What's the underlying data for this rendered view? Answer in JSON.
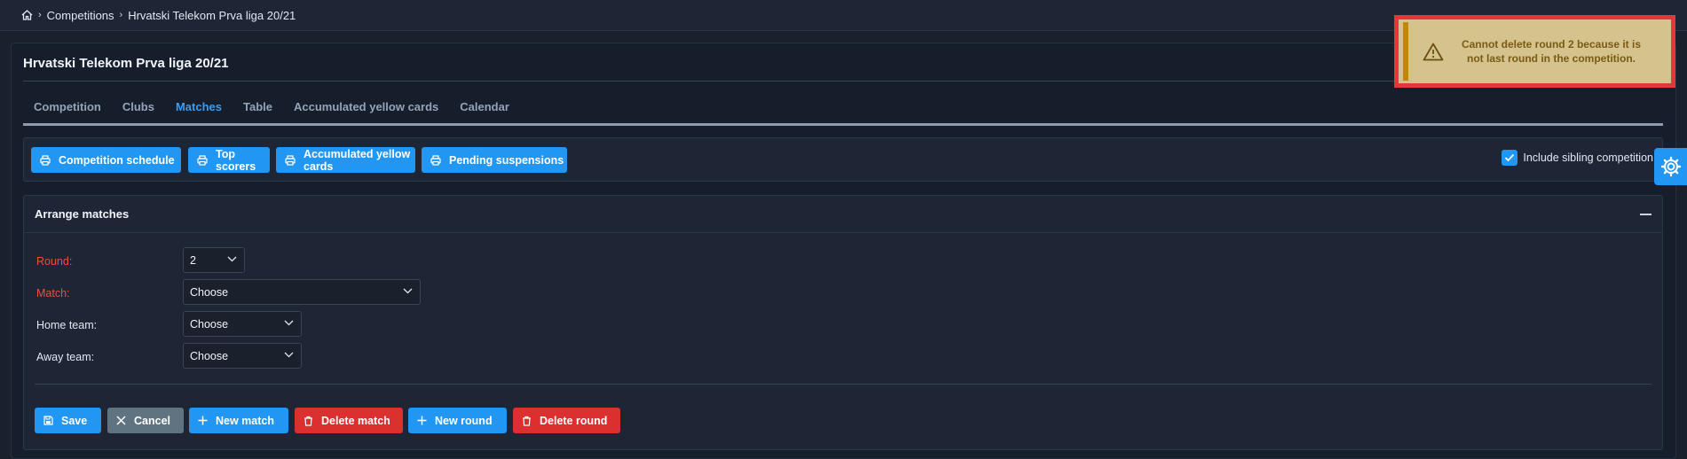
{
  "breadcrumb": {
    "items": [
      "Competitions",
      "Hrvatski Telekom Prva liga 20/21"
    ]
  },
  "page": {
    "title": "Hrvatski Telekom Prva liga 20/21"
  },
  "tabs": [
    {
      "label": "Competition",
      "active": false
    },
    {
      "label": "Clubs",
      "active": false
    },
    {
      "label": "Matches",
      "active": true
    },
    {
      "label": "Table",
      "active": false
    },
    {
      "label": "Accumulated yellow cards",
      "active": false
    },
    {
      "label": "Calendar",
      "active": false
    }
  ],
  "print_buttons": {
    "schedule": "Competition schedule",
    "top_scorers": "Top scorers",
    "yellow_cards": "Accumulated yellow cards",
    "suspensions": "Pending suspensions"
  },
  "sibling": {
    "label": "Include sibling competition",
    "checked": true
  },
  "arrange": {
    "title": "Arrange matches",
    "round_label": "Round:",
    "round_value": "2",
    "match_label": "Match:",
    "match_value": "Choose",
    "home_label": "Home team:",
    "home_value": "Choose",
    "away_label": "Away team:",
    "away_value": "Choose"
  },
  "actions": {
    "save": "Save",
    "cancel": "Cancel",
    "new_match": "New match",
    "delete_match": "Delete match",
    "new_round": "New round",
    "delete_round": "Delete round"
  },
  "toast": {
    "message": "Cannot delete round 2 because it is not last round in the competition.",
    "type": "warning"
  },
  "icons": [
    "home-icon",
    "chevron-right-icon",
    "printer-icon",
    "checkbox-checked-icon",
    "gear-icon",
    "minus-icon",
    "chevron-down-icon",
    "save-icon",
    "close-icon",
    "plus-icon",
    "trash-icon",
    "warning-icon"
  ],
  "colors": {
    "accent": "#2196f3",
    "danger": "#dc2f2f",
    "neutral": "#5f7480",
    "warning_bg": "#d4c38c",
    "required_label": "#e2533d"
  }
}
